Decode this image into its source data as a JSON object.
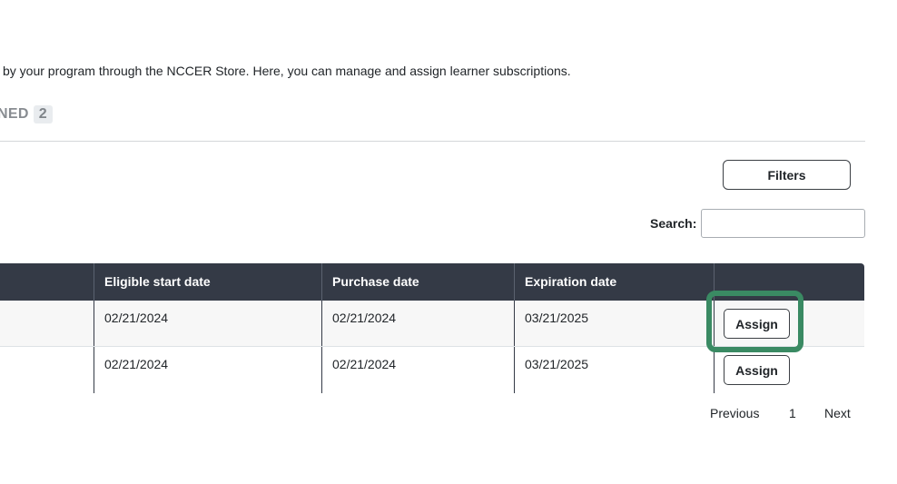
{
  "header": {
    "title_fragment": ":",
    "intro_text": "l by your program through the NCCER Store. Here, you can manage and assign learner subscriptions."
  },
  "tabs": [
    {
      "label": "NED",
      "count": "2"
    }
  ],
  "toolbar": {
    "filters_label": "Filters",
    "search_label": "Search:",
    "search_value": ""
  },
  "table": {
    "columns": [
      "",
      "Eligible start date",
      "Purchase date",
      "Expiration date",
      ""
    ],
    "rows": [
      {
        "eligible_start": "02/21/2024",
        "purchase": "02/21/2024",
        "expiration": "03/21/2025",
        "action": "Assign"
      },
      {
        "eligible_start": "02/21/2024",
        "purchase": "02/21/2024",
        "expiration": "03/21/2025",
        "action": "Assign"
      }
    ]
  },
  "pagination": {
    "previous": "Previous",
    "current_page": "1",
    "next": "Next"
  },
  "colors": {
    "table_header_bg": "#343a46",
    "highlight": "#3a8a63",
    "alt_row_bg": "#f7f7f7"
  }
}
